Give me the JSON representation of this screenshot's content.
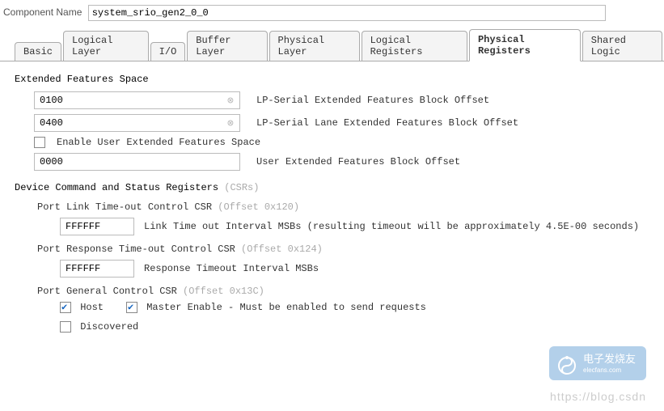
{
  "component_name_label": "Component Name",
  "component_name_value": "system_srio_gen2_0_0",
  "tabs": [
    {
      "label": "Basic"
    },
    {
      "label": "Logical Layer"
    },
    {
      "label": "I/O"
    },
    {
      "label": "Buffer Layer"
    },
    {
      "label": "Physical Layer"
    },
    {
      "label": "Logical Registers"
    },
    {
      "label": "Physical Registers"
    },
    {
      "label": "Shared Logic"
    }
  ],
  "extended": {
    "title": "Extended Features Space",
    "lp_serial_value": "0100",
    "lp_serial_label": "LP-Serial Extended Features Block Offset",
    "lp_lane_value": "0400",
    "lp_lane_label": "LP-Serial Lane Extended Features Block Offset",
    "enable_user_label": "Enable User Extended Features Space",
    "user_block_value": "0000",
    "user_block_label": "User Extended Features Block Offset"
  },
  "csrs": {
    "title": "Device Command and Status Registers",
    "title_suffix": "(CSRs)",
    "port_link": {
      "label": "Port Link Time-out Control CSR",
      "offset": "(Offset 0x120)",
      "value": "FFFFFF",
      "desc": "Link Time out Interval MSBs (resulting timeout will be approximately 4.5E-00 seconds)"
    },
    "port_response": {
      "label": "Port Response Time-out Control CSR",
      "offset": "(Offset 0x124)",
      "value": "FFFFFF",
      "desc": "Response Timeout Interval MSBs"
    },
    "port_general": {
      "label": "Port General Control CSR",
      "offset": "(Offset 0x13C)",
      "host_label": "Host",
      "master_label": "Master Enable - Must be enabled to send requests",
      "discovered_label": "Discovered"
    }
  },
  "watermark_url": "https://blog.csdn",
  "watermark_brand": "电子发烧友",
  "watermark_brand_sub": "elecfans.com"
}
